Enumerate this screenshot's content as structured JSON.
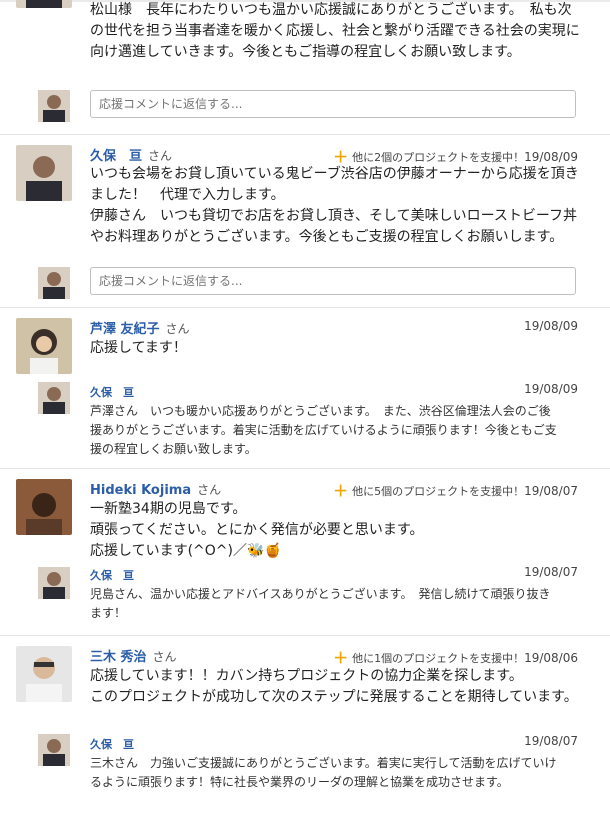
{
  "entries": [
    {
      "body": "松山様　長年にわたりいつも温かい応援誠にありがとうございます。　私も次の世代を担う当事者達を暖かく応援し、社会と繋がり活躍できる社会の実現に向け邁進していきます。今後ともご指導の程宜しくお願い致します。",
      "reply_placeholder": "応援コメントに返信する..."
    },
    {
      "name": "久保　亘",
      "honorific": "さん",
      "projects": "他に2個のプロジェクトを支援中！",
      "date": "19/08/09",
      "body": "いつも会場をお貸し頂いている鬼ビーブ渋谷店の伊藤オーナーから応援を頂きました！　代理で入力します。\n伊藤さん　いつも貸切でお店をお貸し頂き、そして美味しいローストビーフ丼やお料理ありがとうございます。今後ともご支援の程宜しくお願いします。",
      "reply_placeholder": "応援コメントに返信する..."
    },
    {
      "name": "芦澤 友紀子",
      "honorific": "さん",
      "date": "19/08/09",
      "body": "応援してます！",
      "reply": {
        "name": "久保　亘",
        "date": "19/08/09",
        "text": "芦澤さん　いつも暖かい応援ありがとうございます。　また、渋谷区倫理法人会のご後援ありがとうございます。着実に活動を広げていけるように頑張ります！今後ともご支援の程宜しくお願い致します。"
      }
    },
    {
      "name": "Hideki Kojima",
      "honorific": "さん",
      "projects": "他に5個のプロジェクトを支援中！",
      "date": "19/08/07",
      "body": "一新塾34期の児島です。\n頑張ってください。とにかく発信が必要と思います。\n応援しています(^O^)／🐝🍯",
      "reply": {
        "name": "久保　亘",
        "date": "19/08/07",
        "text": "児島さん、温かい応援とアドバイスありがとうございます。　発信し続けて頑張り抜きます！"
      }
    },
    {
      "name": "三木 秀治",
      "honorific": "さん",
      "projects": "他に1個のプロジェクトを支援中！",
      "date": "19/08/06",
      "body": "応援しています！！カバン持ちプロジェクトの協力企業を探します。\nこのプロジェクトが成功して次のステップに発展することを期待しています。",
      "reply": {
        "name": "久保　亘",
        "date": "19/08/07",
        "text": "三木さん　力強いご支援誠にありがとうございます。着実に実行して活動を広げていけるように頑張ります！特に社長や業界のリーダの理解と協業を成功させます。"
      }
    }
  ]
}
